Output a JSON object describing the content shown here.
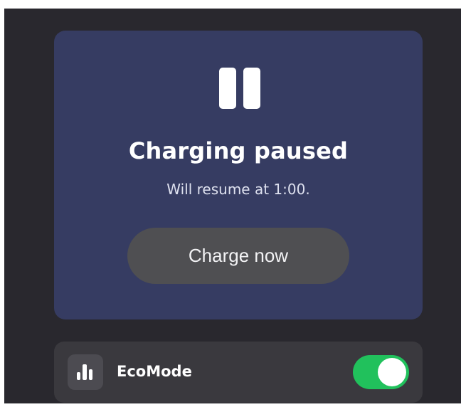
{
  "status_card": {
    "icon": "pause-icon",
    "title": "Charging paused",
    "subtitle": "Will resume at 1:00.",
    "action_label": "Charge now"
  },
  "eco_mode": {
    "icon": "bar-chart-icon",
    "label": "EcoMode",
    "enabled": true,
    "toggle_color": "#21c15c"
  },
  "colors": {
    "background": "#29282e",
    "status_card": "#363c62",
    "charge_button": "#4f4f52",
    "eco_card": "#3a393e"
  }
}
